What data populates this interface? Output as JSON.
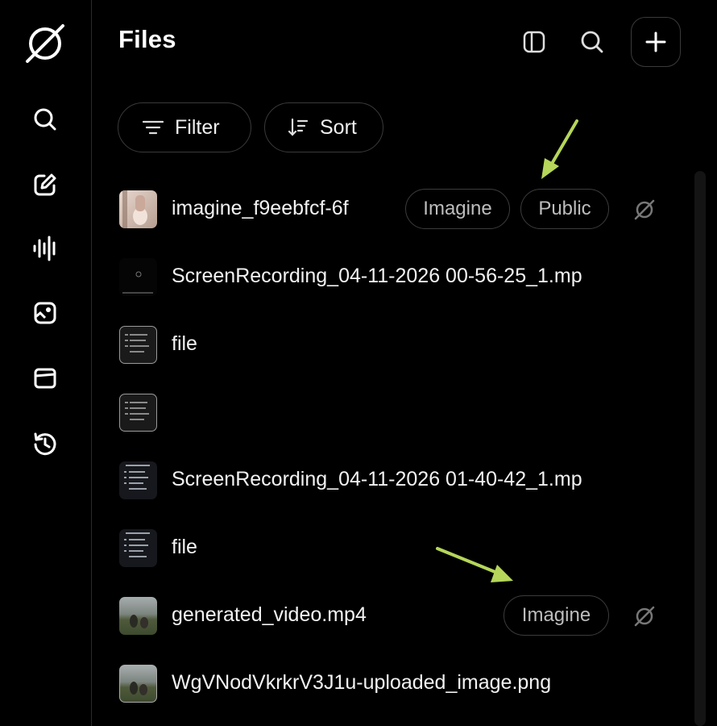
{
  "header": {
    "title": "Files",
    "icons": [
      "sidebar-toggle-icon",
      "search-icon",
      "plus-icon"
    ]
  },
  "rail": {
    "items": [
      "search-icon",
      "edit-icon",
      "voice-icon",
      "image-icon",
      "folder-icon",
      "history-icon"
    ]
  },
  "toolbar": {
    "filter_label": "Filter",
    "sort_label": "Sort"
  },
  "files": [
    {
      "name": "imagine_f9eebfcf-6f",
      "tags": [
        "Imagine",
        "Public"
      ],
      "thumb": "photo-person"
    },
    {
      "name": "ScreenRecording_04-11-2026 00-56-25_1.mp",
      "tags": [],
      "thumb": "dark-recording"
    },
    {
      "name": "file",
      "tags": [],
      "thumb": "screenshot"
    },
    {
      "name": "",
      "tags": [],
      "thumb": "screenshot"
    },
    {
      "name": "ScreenRecording_04-11-2026 01-40-42_1.mp",
      "tags": [],
      "thumb": "screenshot-dark"
    },
    {
      "name": "file",
      "tags": [],
      "thumb": "screenshot-dark"
    },
    {
      "name": "generated_video.mp4",
      "tags": [
        "Imagine"
      ],
      "thumb": "landscape"
    },
    {
      "name": "WgVNodVkrkrV3J1u-uploaded_image.png",
      "tags": [],
      "thumb": "landscape"
    }
  ],
  "colors": {
    "background": "#000000",
    "border": "#3a3a3a",
    "tag_text": "#bdbdbd",
    "annotation_arrow": "#b5d65a"
  }
}
